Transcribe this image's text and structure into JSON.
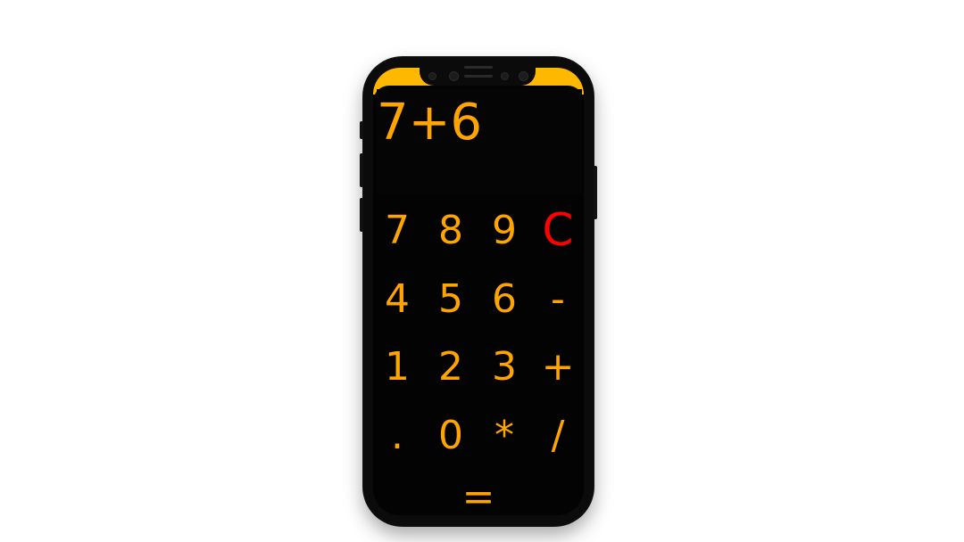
{
  "display": {
    "expression": "7+6"
  },
  "keypad": {
    "row1": [
      "7",
      "8",
      "9",
      "C"
    ],
    "row2": [
      "4",
      "5",
      "6",
      "-"
    ],
    "row3": [
      "1",
      "2",
      "3",
      "+"
    ],
    "row4": [
      ".",
      "0",
      "*",
      "/"
    ],
    "equals": "="
  },
  "colors": {
    "key_text": "#FFA500",
    "clear_text": "#FF0000",
    "status_bar": "#FFB800",
    "background": "#030303"
  }
}
